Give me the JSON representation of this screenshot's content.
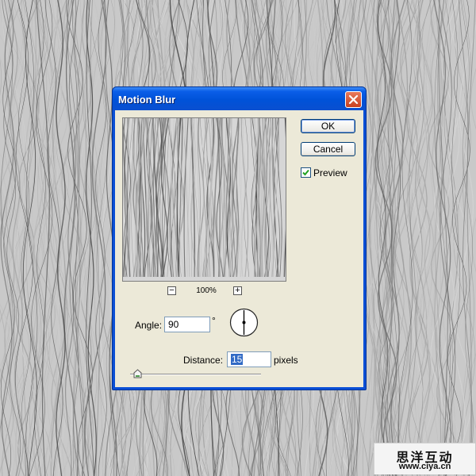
{
  "dialog": {
    "title": "Motion Blur",
    "ok_label": "OK",
    "cancel_label": "Cancel",
    "preview_label": "Preview",
    "preview_checked": true,
    "zoom_minus": "−",
    "zoom_value": "100%",
    "zoom_plus": "+",
    "angle_label": "Angle:",
    "angle_value": "90",
    "angle_unit": "°",
    "distance_label": "Distance:",
    "distance_value": "15",
    "distance_unit": "pixels"
  },
  "watermark": {
    "name": "思洋互动",
    "url": "www.ciya.cn"
  },
  "icons": {
    "close": "close-icon",
    "check": "checkmark-icon",
    "dial": "angle-dial-icon"
  },
  "colors": {
    "title_bar": "#0a4fd6",
    "close_button": "#d2512f",
    "selection": "#316ac5"
  }
}
